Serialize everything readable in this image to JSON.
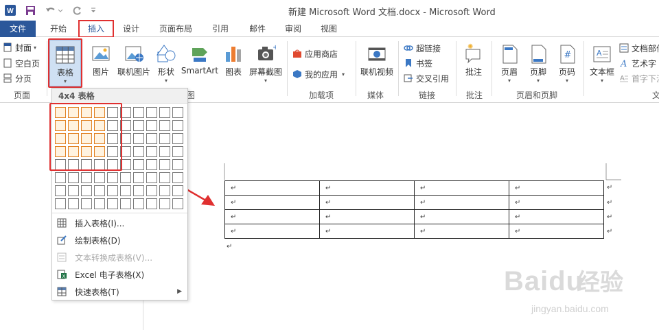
{
  "app": {
    "title": "新建 Microsoft Word 文档.docx - Microsoft Word",
    "qat": [
      "save-icon",
      "undo-icon",
      "redo-icon",
      "customize-icon"
    ]
  },
  "tabs": [
    {
      "label": "文件"
    },
    {
      "label": "开始"
    },
    {
      "label": "插入"
    },
    {
      "label": "设计"
    },
    {
      "label": "页面布局"
    },
    {
      "label": "引用"
    },
    {
      "label": "邮件"
    },
    {
      "label": "审阅"
    },
    {
      "label": "视图"
    }
  ],
  "ribbon": {
    "pages": {
      "cover": "封面",
      "blank": "空白页",
      "break": "分页",
      "group": "页面"
    },
    "table": {
      "label": "表格"
    },
    "illustrations": {
      "picture": "图片",
      "online_picture": "联机图片",
      "shapes": "形状",
      "smartart": "SmartArt",
      "chart": "图表",
      "screenshot": "屏幕截图",
      "group_tail": "图"
    },
    "addins": {
      "store": "应用商店",
      "my_apps": "我的应用",
      "group": "加载项"
    },
    "media": {
      "online_video": "联机视频",
      "group": "媒体"
    },
    "links": {
      "hyperlink": "超链接",
      "bookmark": "书签",
      "crossref": "交叉引用",
      "group": "链接"
    },
    "comments": {
      "comment": "批注",
      "group": "批注"
    },
    "header_footer": {
      "header": "页眉",
      "footer": "页脚",
      "page_number": "页码",
      "group": "页眉和页脚"
    },
    "text": {
      "textbox": "文本框",
      "quickparts": "文档部件",
      "wordart": "艺术字",
      "dropcap": "首字下沉",
      "group_tail": "文"
    }
  },
  "dropdown": {
    "header": "4x4 表格",
    "grid": {
      "cols": 10,
      "rows": 8,
      "sel_cols": 4,
      "sel_rows": 4
    },
    "items": [
      {
        "label": "插入表格(I)...",
        "icon": "insert-table-icon",
        "disabled": false
      },
      {
        "label": "绘制表格(D)",
        "icon": "draw-table-icon",
        "disabled": false
      },
      {
        "label": "文本转换成表格(V)...",
        "icon": "convert-text-icon",
        "disabled": true
      },
      {
        "label": "Excel 电子表格(X)",
        "icon": "excel-icon",
        "disabled": false
      },
      {
        "label": "快速表格(T)",
        "icon": "quick-table-icon",
        "disabled": false
      }
    ]
  },
  "document": {
    "table": {
      "rows": 4,
      "cols": 4,
      "cell_mark": "↵"
    },
    "para_mark": "↵"
  },
  "watermark": {
    "brand": "Baidu",
    "cn": "经验",
    "url": "jingyan.baidu.com"
  },
  "colors": {
    "accent": "#2b579a",
    "highlight": "#e03030",
    "grid_sel": "#e08020"
  }
}
